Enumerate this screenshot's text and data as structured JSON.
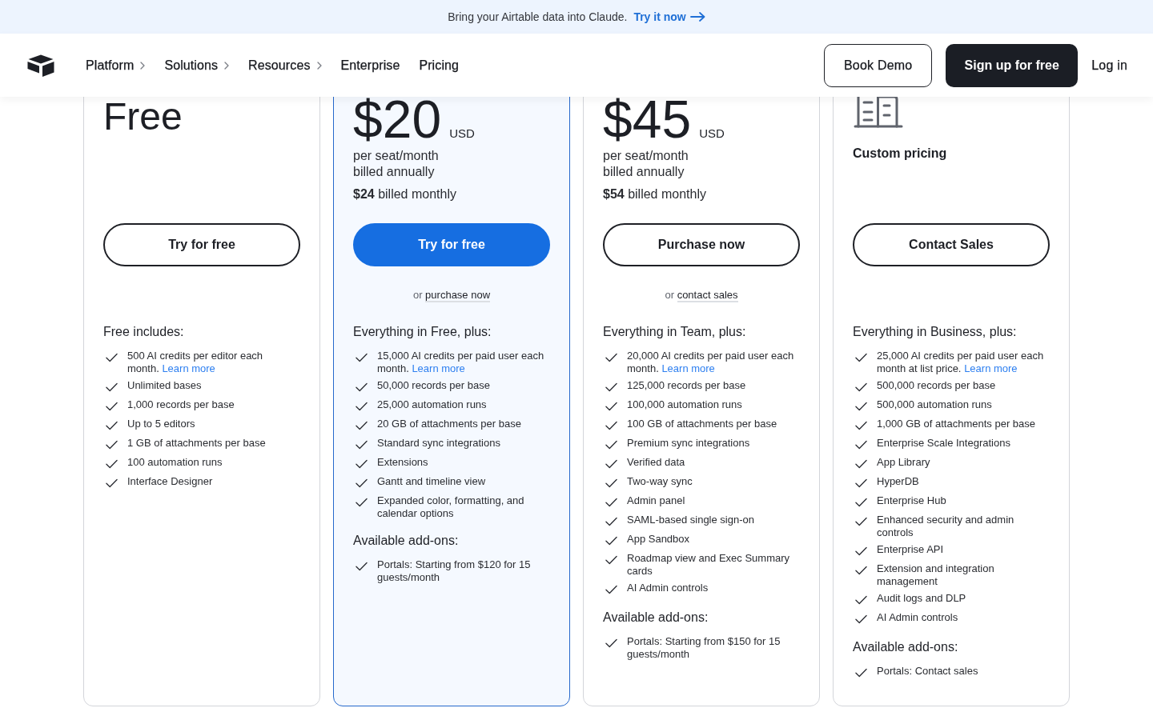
{
  "announcement": {
    "text": "Bring your Airtable data into Claude.",
    "link": "Try it now"
  },
  "header": {
    "nav": [
      {
        "label": "Platform",
        "dropdown": true
      },
      {
        "label": "Solutions",
        "dropdown": true
      },
      {
        "label": "Resources",
        "dropdown": true
      },
      {
        "label": "Enterprise",
        "dropdown": false
      },
      {
        "label": "Pricing",
        "dropdown": false
      }
    ],
    "actions": [
      {
        "label": "Book Demo",
        "kind": "outline"
      },
      {
        "label": "Sign up for free",
        "kind": "solid"
      },
      {
        "label": "Log in",
        "kind": "text"
      }
    ]
  },
  "plans": [
    {
      "kind": "label",
      "featured": false,
      "headline": "Free",
      "button": "Try for free",
      "features_heading": "Free includes:",
      "features": [
        {
          "text": "500 AI credits per editor each month.",
          "link": "Learn more"
        },
        {
          "text": "Unlimited bases"
        },
        {
          "text": "1,000 records per base"
        },
        {
          "text": "Up to 5 editors"
        },
        {
          "text": "1 GB of attachments per base"
        },
        {
          "text": "100 automation runs"
        },
        {
          "text": "Interface Designer"
        }
      ]
    },
    {
      "kind": "price",
      "featured": true,
      "price": "$20",
      "currency": "USD",
      "period": "per seat/month",
      "billing": "billed annually",
      "monthly": "**$24** billed monthly",
      "button": "Try for free",
      "alt_action": {
        "prefix": "or",
        "link": "purchase now"
      },
      "features_heading": "Everything in Free, plus:",
      "features": [
        {
          "text": "15,000 AI credits per paid user each month.",
          "link": "Learn more"
        },
        {
          "text": "50,000 records per base"
        },
        {
          "text": "25,000 automation runs"
        },
        {
          "text": "20 GB of attachments per base"
        },
        {
          "text": "Standard sync integrations"
        },
        {
          "text": "Extensions"
        },
        {
          "text": "Gantt and timeline view"
        },
        {
          "text": "Expanded color, formatting, and calendar options"
        }
      ],
      "addons_heading": "Available add-ons:",
      "addons": [
        "Portals: Starting from $120 for 15 guests/month"
      ]
    },
    {
      "kind": "price",
      "featured": false,
      "price": "$45",
      "currency": "USD",
      "period": "per seat/month",
      "billing": "billed annually",
      "monthly": "**$54** billed monthly",
      "button": "Purchase now",
      "alt_action": {
        "prefix": "or",
        "link": "contact sales"
      },
      "features_heading": "Everything in Team, plus:",
      "features": [
        {
          "text": "20,000 AI credits per paid user each month.",
          "link": "Learn more"
        },
        {
          "text": "125,000 records per base"
        },
        {
          "text": "100,000 automation runs"
        },
        {
          "text": "100 GB of attachments per base"
        },
        {
          "text": "Premium sync integrations"
        },
        {
          "text": "Verified data"
        },
        {
          "text": "Two-way sync"
        },
        {
          "text": "Admin panel"
        },
        {
          "text": "SAML-based single sign-on"
        },
        {
          "text": "App Sandbox"
        },
        {
          "text": "Roadmap view and Exec Summary cards"
        },
        {
          "text": "AI Admin controls"
        }
      ],
      "addons_heading": "Available add-ons:",
      "addons": [
        "Portals: Starting from $150 for 15 guests/month"
      ]
    },
    {
      "kind": "custom",
      "featured": false,
      "headline": "Custom pricing",
      "button": "Contact Sales",
      "features_heading": "Everything in Business, plus:",
      "features": [
        {
          "text": "25,000 AI credits per paid user each month at list price.",
          "link": "Learn more"
        },
        {
          "text": "500,000 records per base"
        },
        {
          "text": "500,000 automation runs"
        },
        {
          "text": "1,000 GB of attachments per base"
        },
        {
          "text": "Enterprise Scale Integrations"
        },
        {
          "text": "App Library"
        },
        {
          "text": "HyperDB"
        },
        {
          "text": "Enterprise Hub"
        },
        {
          "text": "Enhanced security and admin controls"
        },
        {
          "text": "Enterprise API"
        },
        {
          "text": "Extension and integration management"
        },
        {
          "text": "Audit logs and DLP"
        },
        {
          "text": "AI Admin controls"
        }
      ],
      "addons_heading": "Available add-ons:",
      "addons": [
        "Portals: Contact sales"
      ]
    }
  ]
}
